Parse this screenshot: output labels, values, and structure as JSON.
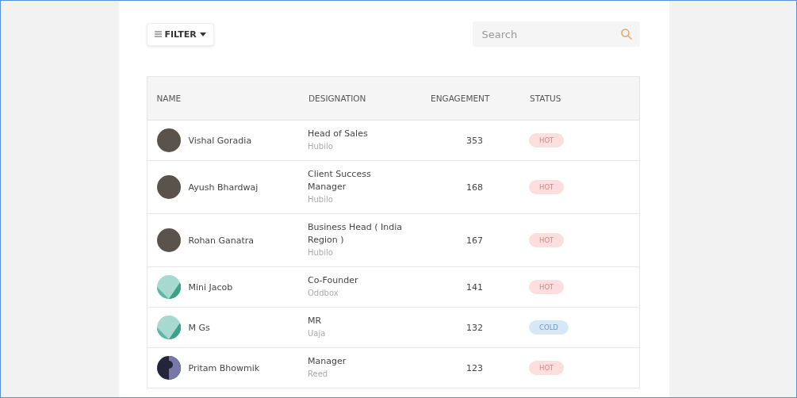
{
  "toolbar": {
    "filter_label": "FILTER",
    "search": {
      "placeholder": "Search"
    }
  },
  "table": {
    "columns": [
      "NAME",
      "DESIGNATION",
      "ENGAGEMENT",
      "STATUS"
    ],
    "rows": [
      {
        "avatar": {
          "kind": "photo"
        },
        "name": "Vishal Goradia",
        "designation": "Head of Sales",
        "company": "Hubilo",
        "engagement": "353",
        "status": {
          "label": "HOT",
          "kind": "hot"
        }
      },
      {
        "avatar": {
          "kind": "photo"
        },
        "name": "Ayush Bhardwaj",
        "designation": "Client Success Manager",
        "company": "Hubilo",
        "engagement": "168",
        "status": {
          "label": "HOT",
          "kind": "hot"
        }
      },
      {
        "avatar": {
          "kind": "photo"
        },
        "name": "Rohan Ganatra",
        "designation": "Business Head ( India Region )",
        "company": "Hubilo",
        "engagement": "167",
        "status": {
          "label": "HOT",
          "kind": "hot"
        }
      },
      {
        "avatar": {
          "kind": "pattern"
        },
        "name": "Mini Jacob",
        "designation": "Co-Founder",
        "company": "Oddbox",
        "engagement": "141",
        "status": {
          "label": "HOT",
          "kind": "hot"
        }
      },
      {
        "avatar": {
          "kind": "pattern"
        },
        "name": "M Gs",
        "designation": "MR",
        "company": "Uaja",
        "engagement": "132",
        "status": {
          "label": "COLD",
          "kind": "cold"
        }
      },
      {
        "avatar": {
          "kind": "split"
        },
        "name": "Pritam Bhowmik",
        "designation": "Manager",
        "company": "Reed",
        "engagement": "123",
        "status": {
          "label": "HOT",
          "kind": "hot"
        }
      }
    ]
  }
}
